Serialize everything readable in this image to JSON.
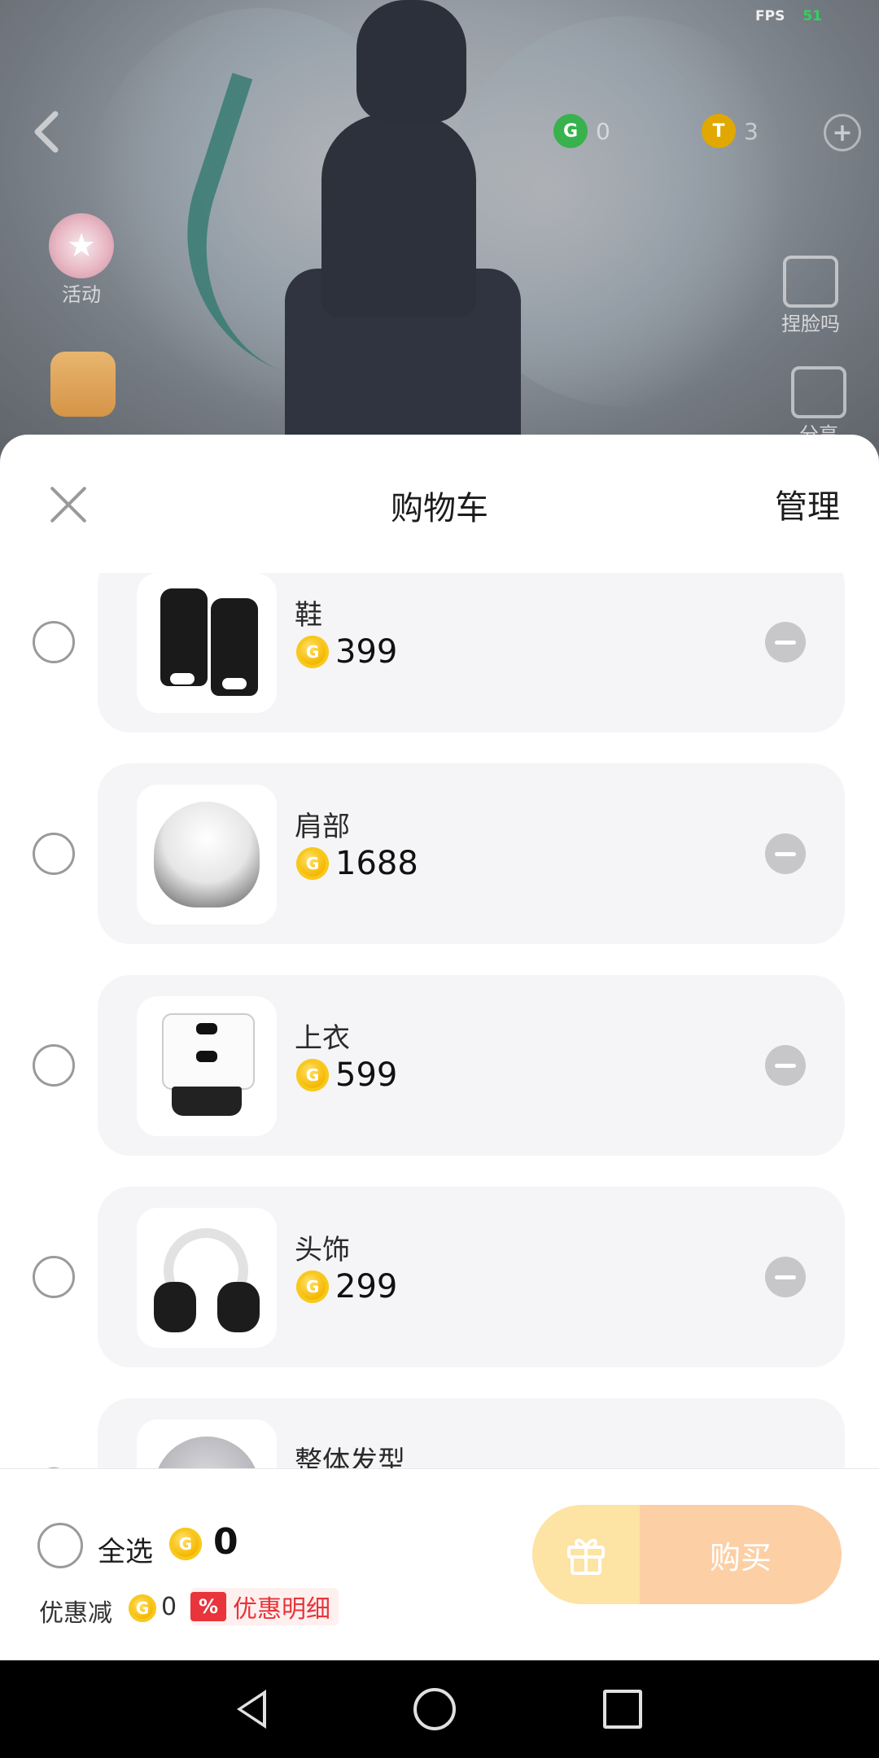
{
  "status": {
    "fps_label": "FPS",
    "fps_value": "51"
  },
  "top_bar": {
    "currency_g": {
      "icon": "g-coin-icon",
      "value": "0"
    },
    "currency_t": {
      "icon": "t-coin-icon",
      "value": "3"
    }
  },
  "side_buttons": {
    "activity_label": "活动",
    "pinch_label": "捏脸吗",
    "share_label": "分享"
  },
  "cart": {
    "title": "购物车",
    "manage_label": "管理",
    "items": [
      {
        "name": "鞋",
        "price": "399"
      },
      {
        "name": "肩部",
        "price": "1688"
      },
      {
        "name": "上衣",
        "price": "599"
      },
      {
        "name": "头饰",
        "price": "299"
      },
      {
        "name": "整体发型",
        "price": ""
      }
    ]
  },
  "footer": {
    "select_all_label": "全选",
    "total_value": "0",
    "discount_label": "优惠减",
    "discount_value": "0",
    "discount_tag": "%",
    "discount_detail_label": "优惠明细",
    "buy_label": "购买"
  },
  "colors": {
    "accent_price_coin": "#f5b800",
    "buy_button": "#fdcfa5",
    "gift_button": "#fde3a4",
    "discount_red": "#e8343a"
  }
}
